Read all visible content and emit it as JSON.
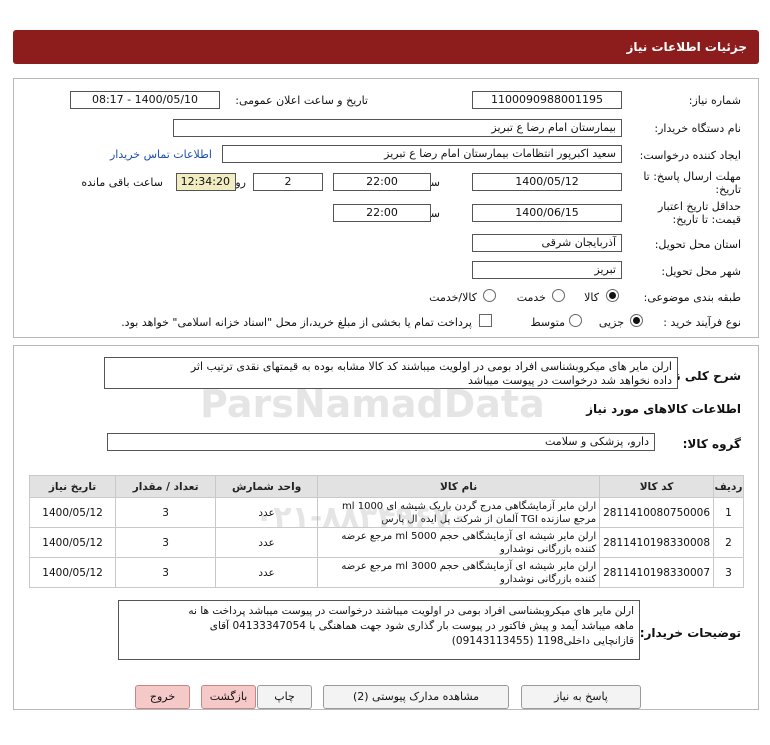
{
  "header": {
    "title": "جزئیات اطلاعات نیاز"
  },
  "fields": {
    "need_number_label": "شماره نیاز:",
    "need_number": "1100090988001195",
    "announce_label": "تاریخ و ساعت اعلان عمومی:",
    "announce_value": "1400/05/10 - 08:17",
    "buyer_label": "نام دستگاه خریدار:",
    "buyer_value": "بیمارستان امام رضا  ع  تبریز",
    "creator_label": "ایجاد کننده درخواست:",
    "creator_value": "سعید اکبرپور انتظامات بیمارستان امام رضا  ع  تبریز",
    "contact_link": "اطلاعات تماس خریدار",
    "reply_label_1": "مهلت ارسال پاسخ: تا",
    "reply_label_2": "تاریخ:",
    "reply_date": "1400/05/12",
    "time_label": "ساعت",
    "reply_time": "22:00",
    "days_value": "2",
    "days_label": "روز و",
    "remaining_time": "12:34:20",
    "remaining_label": "ساعت باقی مانده",
    "validity_label_1": "حداقل تاریخ اعتبار",
    "validity_label_2": "قیمت: تا تاریخ:",
    "validity_date": "1400/06/15",
    "validity_time": "22:00",
    "province_label": "استان محل تحویل:",
    "province_value": "آذربایجان شرقی",
    "city_label": "شهر محل تحویل:",
    "city_value": "تبریز",
    "category_label": "طبقه بندی موضوعی:",
    "category_options": [
      "کالا",
      "خدمت",
      "کالا/خدمت"
    ],
    "process_label": "نوع فرآیند خرید :",
    "process_options": [
      "جزیی",
      "متوسط"
    ],
    "payment_note": "پرداخت تمام یا بخشی از مبلغ خرید،از محل \"اسناد خزانه اسلامی\" خواهد بود."
  },
  "summary": {
    "label": "شرح کلی نیاز:",
    "text_line1": "ارلن مایر های میکروبشناسی افراد بومی در اولویت میباشند کد کالا مشابه بوده به قیمتهای نقدی ترتیب اثر",
    "text_line2": "داده نخواهد شد درخواست در پیوست میباشد"
  },
  "goods_section": {
    "title": "اطلاعات کالاهای مورد نیاز",
    "group_label": "گروه کالا:",
    "group_value": "دارو، پزشکی و سلامت"
  },
  "table": {
    "headers": [
      "ردیف",
      "کد کالا",
      "نام کالا",
      "واحد شمارش",
      "تعداد / مقدار",
      "تاریخ نیاز"
    ],
    "rows": [
      {
        "row": "1",
        "code": "2811410080750006",
        "name_line1": "ارلن مایر آزمایشگاهی مدرج گردن باریک شیشه ای 1000 ml",
        "name_line2": "مرجع سازنده TGI آلمان از شرکت پل ایده ال پارس",
        "unit": "عدد",
        "qty": "3",
        "date": "1400/05/12"
      },
      {
        "row": "2",
        "code": "2811410198330008",
        "name_line1": "ارلن مایر شیشه ای آزمایشگاهی حجم 5000 ml مرجع عرضه",
        "name_line2": "کننده بازرگانی نوشدارو",
        "unit": "عدد",
        "qty": "3",
        "date": "1400/05/12"
      },
      {
        "row": "3",
        "code": "2811410198330007",
        "name_line1": "ارلن مایر شیشه ای آزمایشگاهی حجم 3000 ml مرجع عرضه",
        "name_line2": "کننده بازرگانی نوشدارو",
        "unit": "عدد",
        "qty": "3",
        "date": "1400/05/12"
      }
    ]
  },
  "buyer_notes": {
    "label": "توضیحات خریدار:",
    "line1": "ارلن مایر های میکروبشناسی افراد بومی در اولویت میباشند  درخواست در پیوست میباشد پرداخت ها نه",
    "line2": "ماهه میباشد آیمد و پیش فاکتور در پیوست بار گذاری شود جهت هماهنگی با 04133347054  آقای",
    "line3": "قازانچایی داخلی1198 (09143113455)"
  },
  "buttons": {
    "reply": "پاسخ به نیاز",
    "attachments": "مشاهده مدارک پیوستی (2)",
    "print": "چاپ",
    "back": "بازگشت",
    "exit": "خروج"
  },
  "watermark": {
    "brand": "ParsNamadData",
    "phone": "۰۲۱-۸۸۳۴۹۶۷۰"
  }
}
